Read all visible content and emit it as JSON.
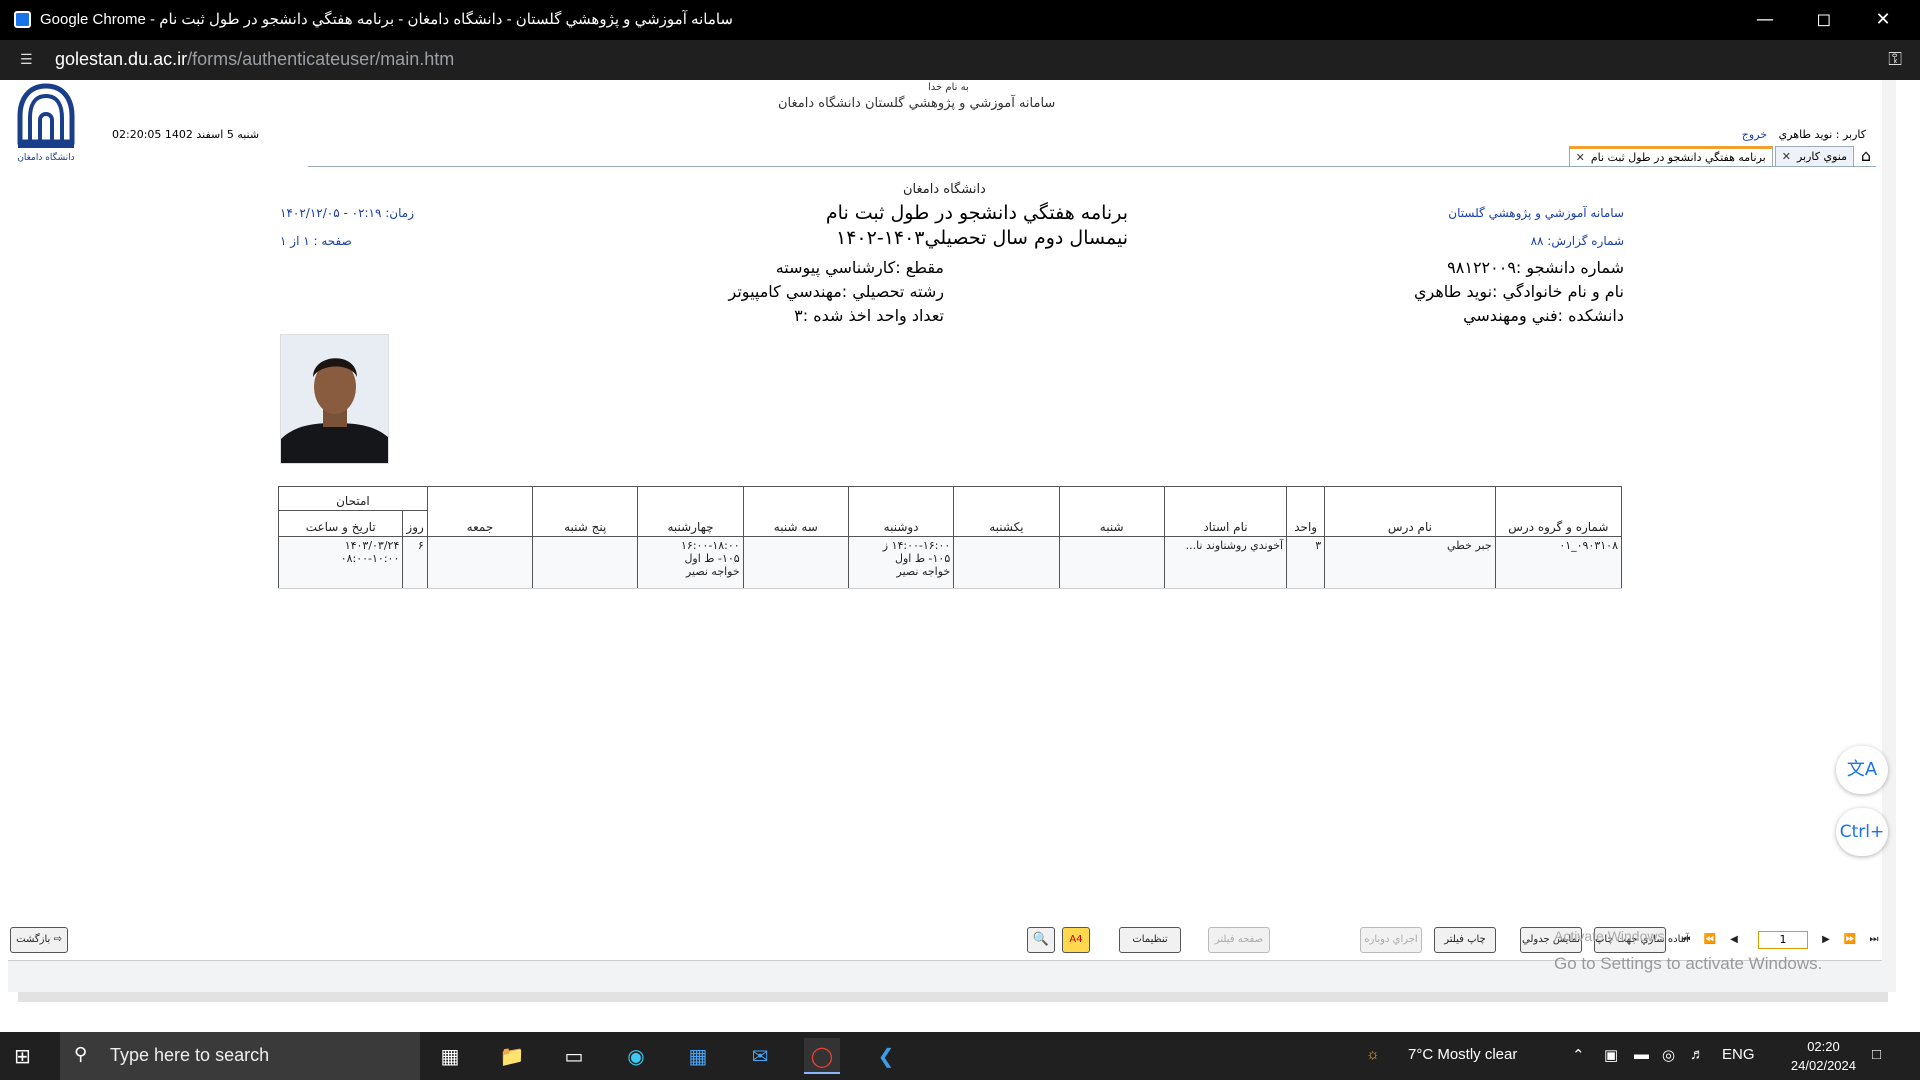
{
  "window": {
    "title": "Google Chrome - سامانه آموزشي و پژوهشي گلستان - دانشگاه دامغان - برنامه هفتگي دانشجو در طول ثبت نام"
  },
  "addressbar": {
    "domain": "golestan.du.ac.ir",
    "path": "/forms/authenticateuser/main.htm"
  },
  "header": {
    "bismillah": "به نام خدا",
    "system_title": "سامانه آموزشي و پژوهشي گلستان   دانشگاه دامغان",
    "datetime": "02:20:05 شنبه 5 اسفند 1402",
    "user_label": "کاربر : نويد طاهري",
    "logout": "خروج",
    "logo_alt": "دانشگاه دامغان"
  },
  "tabs": [
    {
      "label": "منوي کاربر"
    },
    {
      "label": "برنامه هفتگي دانشجو در طول ثبت نام"
    }
  ],
  "report": {
    "university": "دانشگاه دامغان",
    "title": "برنامه هفتگي دانشجو در طول ثبت نام",
    "semester": "نيمسال دوم سال تحصيلي۱۴۰۳-۱۴۰۲",
    "time": "زمان: ۰۲:۱۹ - ۱۴۰۲/۱۲/۰۵",
    "page": "صفحه : ۱ از ۱",
    "system": "سامانه آموزشي و پژوهشي گلستان",
    "report_number": "شماره گزارش: ۸۸",
    "student_number": "شماره دانشجو :۹۸۱۲۲۰۰۹",
    "name": "نام و نام خانوادگي :نويد طاهري",
    "faculty": "دانشکده :فني ومهندسي",
    "level": "مقطع :کارشناسي پيوسته",
    "major": "رشته تحصيلي :مهندسي کامپيوتر",
    "units_taken": "تعداد واحد اخذ شده :۳"
  },
  "table": {
    "headers": {
      "code": "شماره و گروه درس",
      "course": "نام درس",
      "units": "واحد",
      "teacher": "نام استاد",
      "sat": "شنبه",
      "sun": "يکشنبه",
      "mon": "دوشنبه",
      "tue": "سه شنبه",
      "wed": "چهارشنبه",
      "thu": "پنج شنبه",
      "fri": "جمعه",
      "exam": "امتحان",
      "exam_day": "روز",
      "exam_datetime": "تاريخ و ساعت"
    },
    "rows": [
      {
        "code": "۰۹۰۳۱۰۸_۰۱",
        "course": "جبر خطي",
        "units": "۳",
        "teacher": "آخوندي روشناوند نا...",
        "sat": "",
        "sun": "",
        "mon_line1": "۱۴:۰۰-۱۶:۰۰ ز",
        "mon_line2": "۱۰۵- ط اول",
        "mon_line3": "خواجه نصير",
        "tue": "",
        "wed_line1": "۱۶:۰۰-۱۸:۰۰",
        "wed_line2": "۱۰۵- ط اول",
        "wed_line3": "خواجه نصير",
        "thu": "",
        "fri": "",
        "exam_day": "۶",
        "exam_date": "۱۴۰۳/۰۳/۲۴",
        "exam_time": "۰۸:۰۰-۱۰:۰۰"
      }
    ]
  },
  "toolbar": {
    "back": "بازگشت",
    "settings": "تنظيمات",
    "filter_page": "صفحه فيلتر",
    "rerun": "اجراي دوباره",
    "print_filter": "چاپ فيلتر",
    "show_col": "نمايش جدولي",
    "prepare_print": "آماده سازي جهت چاپ",
    "page_value": "1",
    "a4": "A4"
  },
  "activation": {
    "line1": "Activate Windows",
    "line2": "Go to Settings to activate Windows."
  },
  "float": {
    "translate": "文A",
    "ctrl": "Ctrl+"
  },
  "taskbar": {
    "search_placeholder": "Type here to search",
    "weather": "7°C  Mostly clear",
    "lang": "ENG",
    "time": "02:20",
    "date": "24/02/2024"
  }
}
